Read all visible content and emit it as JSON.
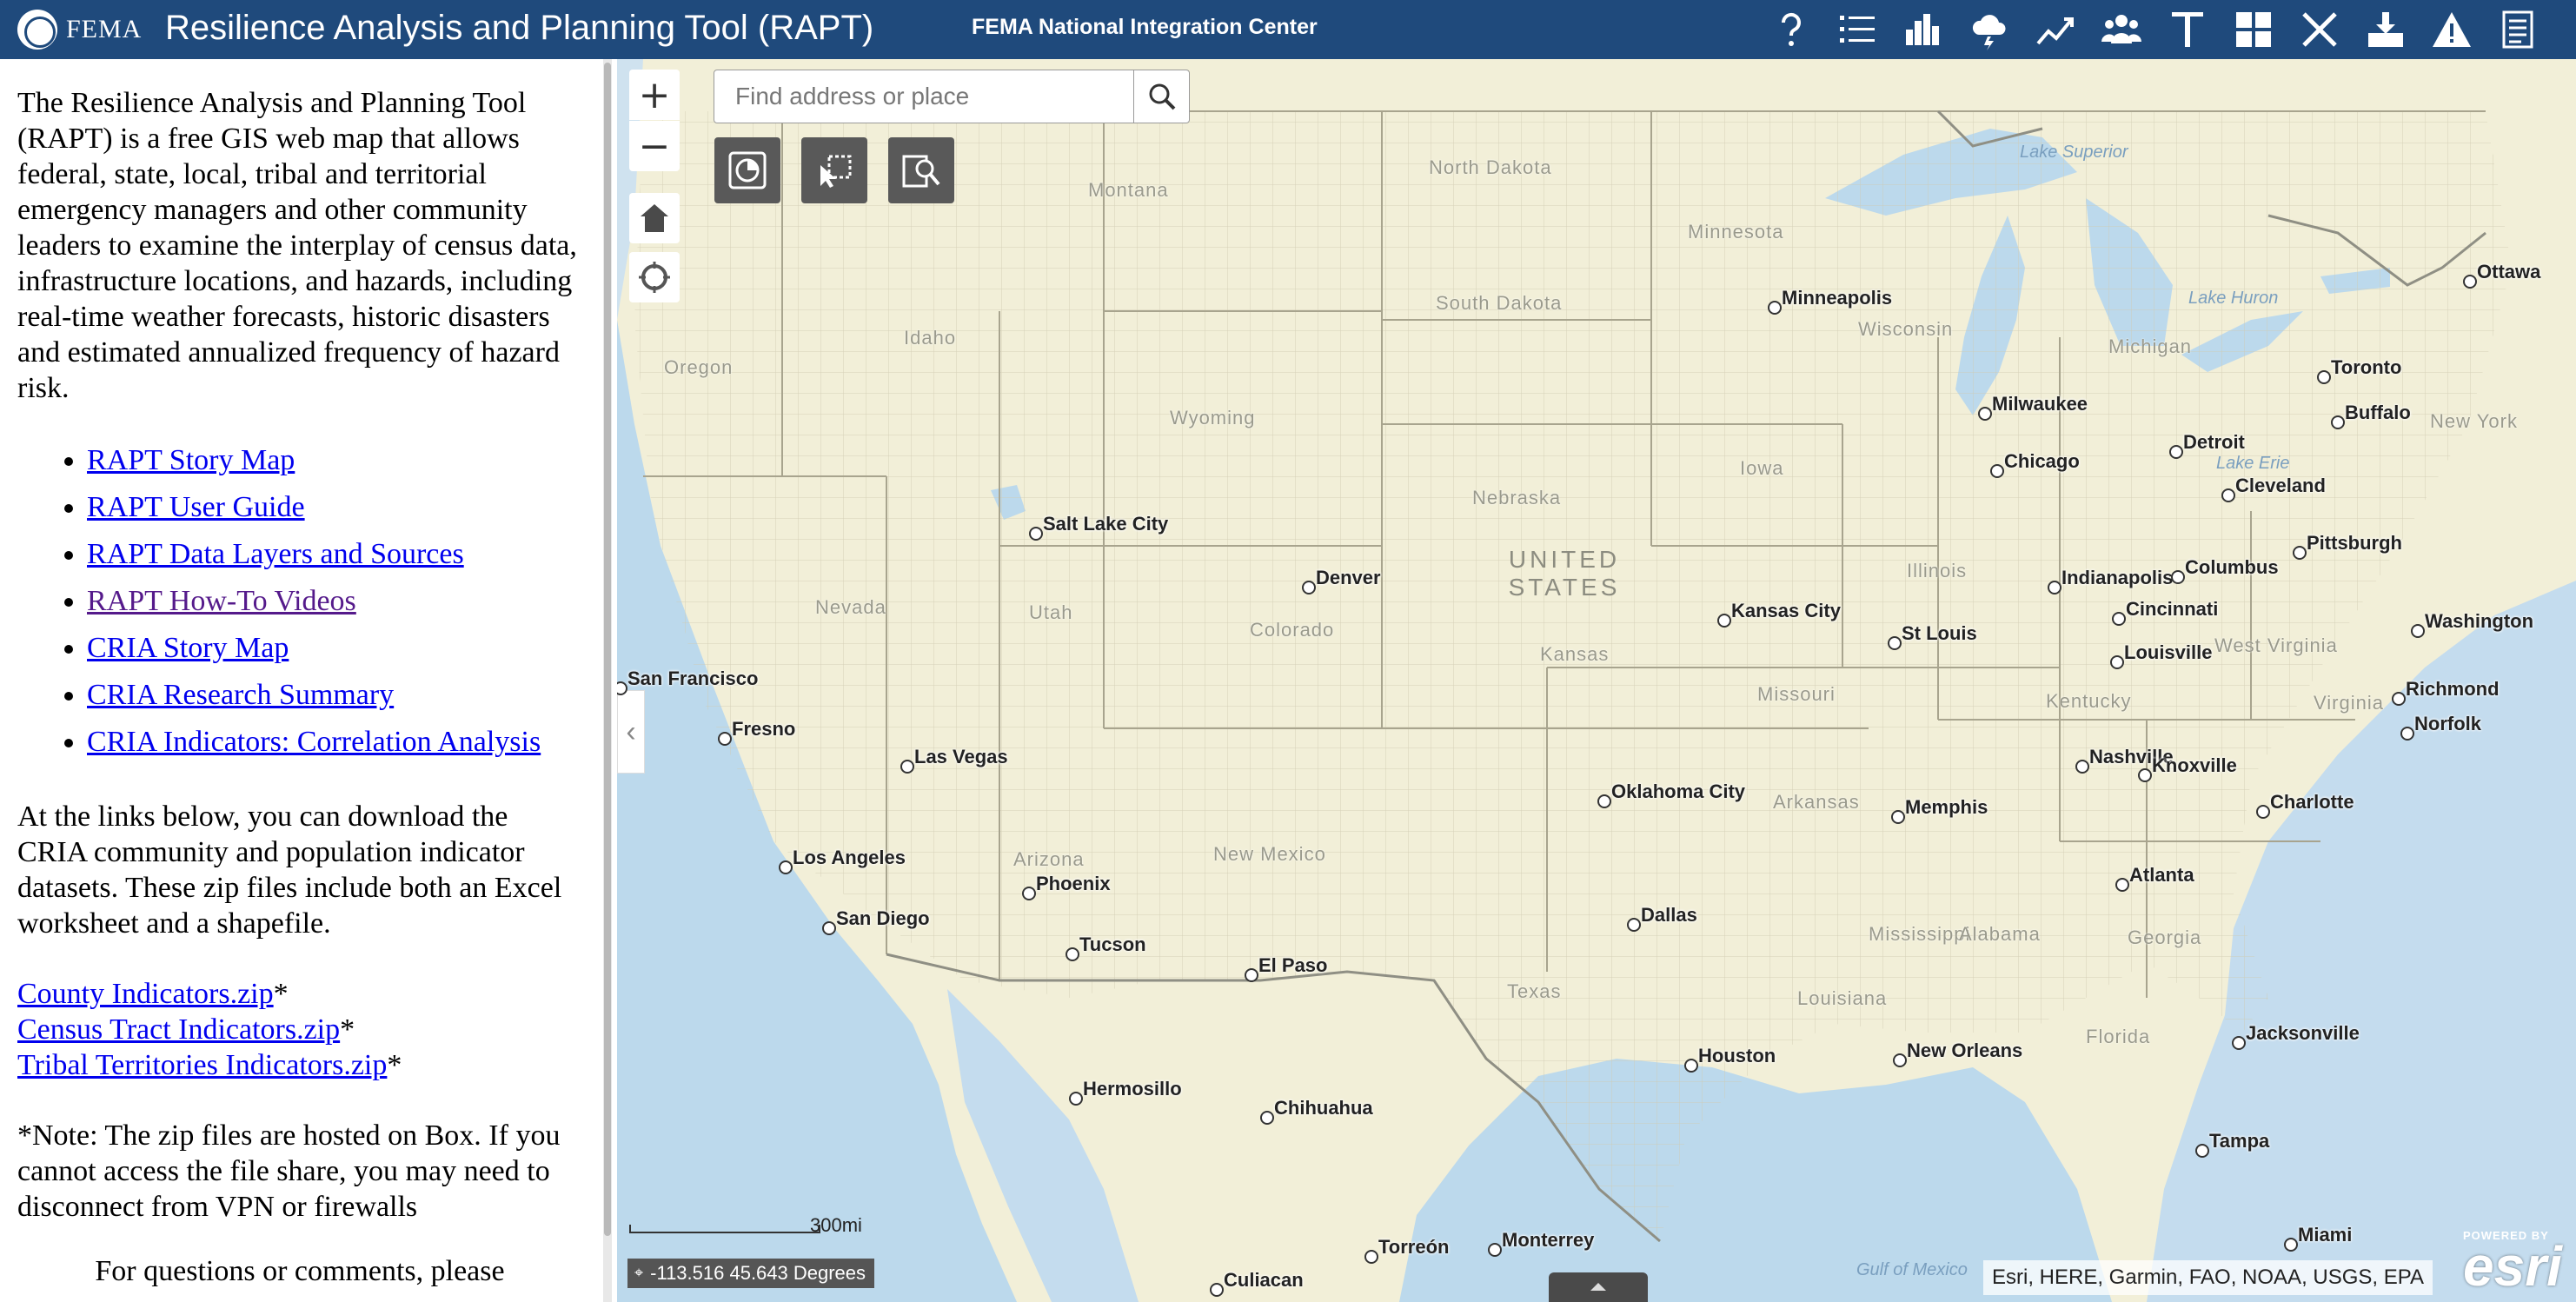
{
  "header": {
    "agency_word": "FEMA",
    "title": "Resilience Analysis and Planning Tool (RAPT)",
    "subtitle": "FEMA National Integration Center",
    "tools": [
      {
        "icon": "help-icon"
      },
      {
        "icon": "layer-list-icon"
      },
      {
        "icon": "chart-icon"
      },
      {
        "icon": "weather-icon"
      },
      {
        "icon": "trend-icon"
      },
      {
        "icon": "people-icon"
      },
      {
        "icon": "text-icon"
      },
      {
        "icon": "grid-icon"
      },
      {
        "icon": "tools-icon"
      },
      {
        "icon": "download-icon"
      },
      {
        "icon": "warning-icon"
      },
      {
        "icon": "checklist-icon"
      }
    ]
  },
  "side_panel": {
    "intro": "The Resilience Analysis and Planning Tool (RAPT) is a free GIS web map that allows federal, state, local, tribal and territorial emergency managers and other community leaders to examine the interplay of census data, infrastructure locations, and hazards, including real-time weather forecasts, historic disasters and estimated annualized frequency of hazard risk.",
    "links": [
      "RAPT Story Map",
      "RAPT User Guide",
      "RAPT Data Layers and Sources",
      "RAPT How-To Videos",
      "CRIA Story Map",
      "CRIA Research Summary",
      "CRIA Indicators: Correlation Analysis"
    ],
    "download_intro": "At the links below, you can download the CRIA community and population indicator datasets. These zip files include both an Excel worksheet and a shapefile.",
    "downloads": [
      "County Indicators.zip",
      "Census Tract Indicators.zip",
      "Tribal Territories Indicators.zip"
    ],
    "asterisk": "*",
    "note": "*Note: The zip files are hosted on Box. If you cannot access the file share, you may need to disconnect from VPN or firewalls",
    "contact": "For questions or comments, please"
  },
  "map": {
    "search_placeholder": "Find address or place",
    "zoom_in": "+",
    "zoom_out": "−",
    "scale_label": "300mi",
    "coordinates": "-113.516 45.643 Degrees",
    "attribution": "Esri, HERE, Garmin, FAO, NOAA, USGS, EPA",
    "esri_powered": "POWERED BY",
    "esri_word": "esri",
    "country_label": "UNITED STATES",
    "region_labels": [
      "Montana",
      "North Dakota",
      "Minnesota",
      "South Dakota",
      "Wisconsin",
      "Idaho",
      "Oregon",
      "Wyoming",
      "Iowa",
      "Nebraska",
      "Nevada",
      "Utah",
      "Colorado",
      "Kansas",
      "Missouri",
      "Illinois",
      "Arkansas",
      "Arizona",
      "New Mexico",
      "Texas",
      "Louisiana",
      "Mississippi",
      "Alabama",
      "Georgia",
      "Florida",
      "Kentucky",
      "West Virginia",
      "Virginia",
      "New York",
      "Michigan"
    ],
    "water_labels": [
      "Lake Superior",
      "Lake Huron",
      "Lake Erie",
      "Gulf of Mexico"
    ],
    "cities": [
      "Minneapolis",
      "Ottawa",
      "Toronto",
      "Milwaukee",
      "Buffalo",
      "Chicago",
      "Detroit",
      "Cleveland",
      "Salt Lake City",
      "Pittsburgh",
      "Denver",
      "Indianapolis",
      "Columbus",
      "Kansas City",
      "Cincinnati",
      "St Louis",
      "Washington",
      "Louisville",
      "San Francisco",
      "Richmond",
      "Fresno",
      "Norfolk",
      "Nashville",
      "Knoxville",
      "Las Vegas",
      "Oklahoma City",
      "Memphis",
      "Charlotte",
      "Los Angeles",
      "Atlanta",
      "Phoenix",
      "San Diego",
      "Dallas",
      "Tucson",
      "El Paso",
      "Jacksonville",
      "Houston",
      "New Orleans",
      "Hermosillo",
      "Chihuahua",
      "Tampa",
      "Miami",
      "Monterrey",
      "Torreón",
      "Culiacan"
    ]
  }
}
